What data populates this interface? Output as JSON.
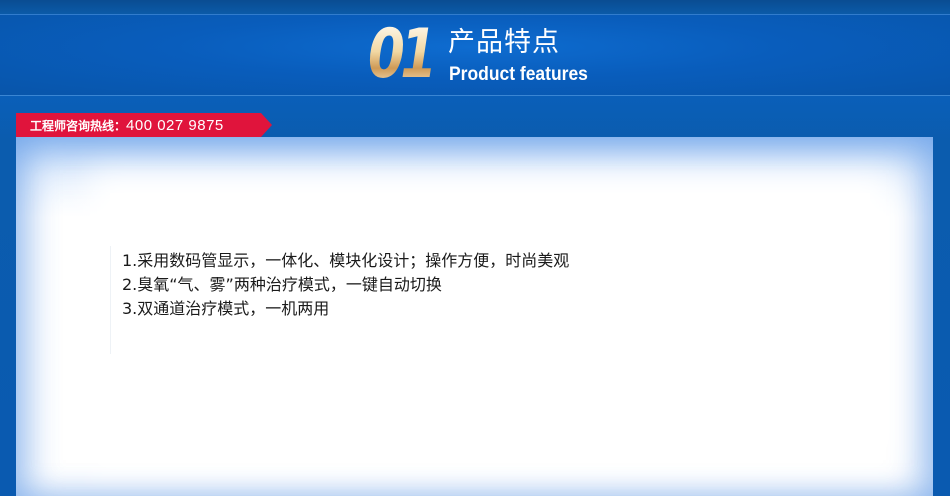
{
  "header": {
    "number": "01",
    "title_cn": "产品特点",
    "title_en": "Product features"
  },
  "hotline": {
    "label": "工程师咨询热线：",
    "number": "400 027 9875"
  },
  "features": [
    {
      "text": "1.采用数码管显示，一体化、模块化设计；操作方便，时尚美观"
    },
    {
      "text": "2.臭氧“气、雾”两种治疗模式，一键自动切换"
    },
    {
      "text": "3.双通道治疗模式，一机两用"
    }
  ],
  "colors": {
    "header_blue": "#0a5fb9",
    "hotline_red": "#e0143c",
    "number_gold": "#f2d8a3",
    "text": "#1a1a1a"
  }
}
